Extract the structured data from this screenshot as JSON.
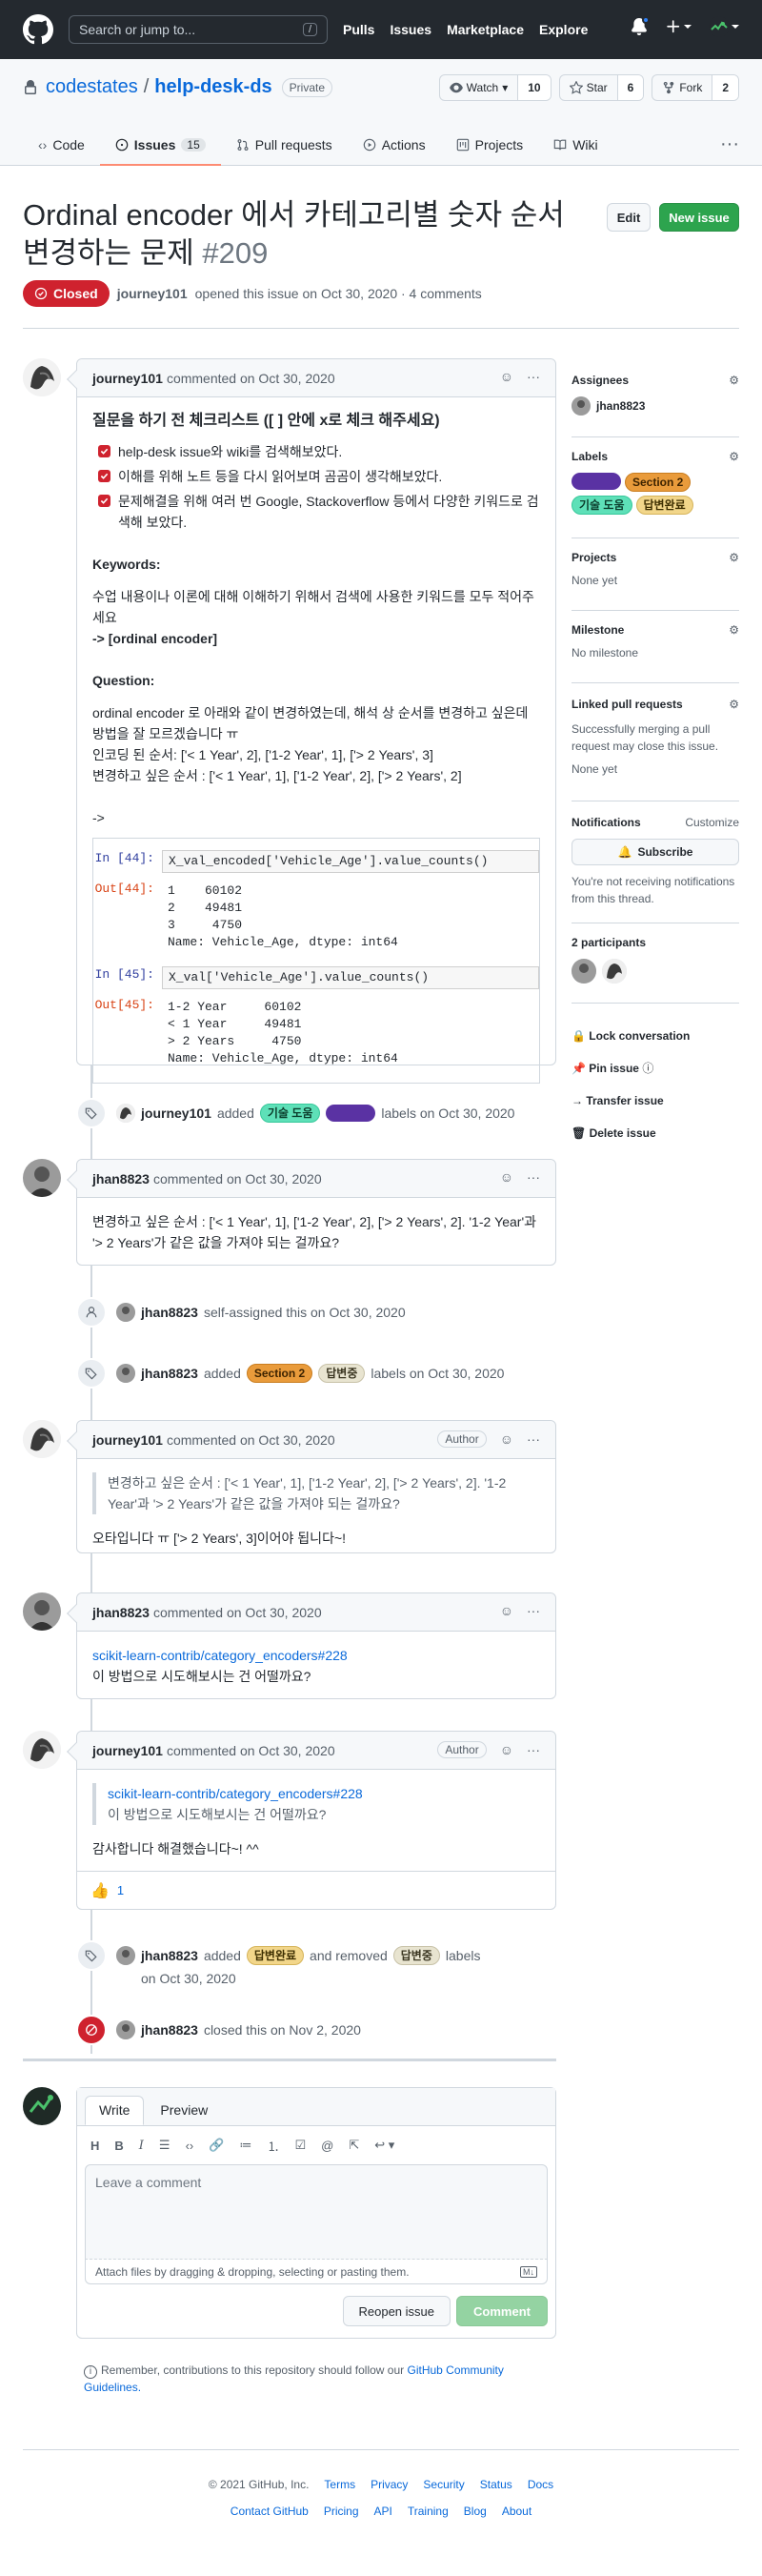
{
  "header": {
    "search_placeholder": "Search or jump to...",
    "search_key": "/",
    "nav": [
      "Pulls",
      "Issues",
      "Marketplace",
      "Explore"
    ]
  },
  "repo": {
    "owner": "codestates",
    "separator": "/",
    "name": "help-desk-ds",
    "visibility": "Private",
    "watch_label": "Watch",
    "watch_count": "10",
    "star_label": "Star",
    "star_count": "6",
    "fork_label": "Fork",
    "fork_count": "2",
    "tabs": [
      {
        "label": "Code"
      },
      {
        "label": "Issues",
        "count": "15"
      },
      {
        "label": "Pull requests"
      },
      {
        "label": "Actions"
      },
      {
        "label": "Projects"
      },
      {
        "label": "Wiki"
      }
    ]
  },
  "issue": {
    "title": "Ordinal encoder 에서 카테고리별 숫자 순서 변경하는 문제",
    "number": "#209",
    "edit_label": "Edit",
    "new_issue_label": "New issue",
    "state": "Closed",
    "author": "journey101",
    "meta_text": "opened this issue on Oct 30, 2020 · 4 comments"
  },
  "first_comment": {
    "author": "journey101",
    "meta": "commented on Oct 30, 2020",
    "heading": "질문을 하기 전 체크리스트 ([ ] 안에 x로 체크 해주세요)",
    "tasks": [
      "help-desk issue와 wiki를 검색해보았다.",
      "이해를 위해 노트 등을 다시 읽어보며 곰곰이 생각해보았다.",
      "문제해결을 위해 여러 번 Google, Stackoverflow 등에서 다양한 키워드로 검색해 보았다."
    ],
    "keywords_h": "Keywords:",
    "keywords_text": "수업 내용이나 이론에 대해 이해하기 위해서 검색에 사용한 키워드를 모두 적어주세요",
    "keywords_value": "-> [ordinal encoder]",
    "question_h": "Question:",
    "q1": "ordinal encoder 로 아래와 같이 변경하였는데, 해석 상 순서를 변경하고 싶은데 방법을 잘 모르겠습니다 ㅠ",
    "q2": "인코딩 된 순서: ['< 1 Year', 2], ['1-2 Year', 1], ['> 2 Years', 3]",
    "q3": "변경하고 싶은 순서 : ['< 1 Year', 1], ['1-2 Year', 2], ['> 2 Years', 2]",
    "arrow": "->",
    "code": {
      "in1_prompt": "In [44]:",
      "in1": "X_val_encoded['Vehicle_Age'].value_counts()",
      "out1_prompt": "Out[44]:",
      "out1": "1    60102\n2    49481\n3     4750\nName: Vehicle_Age, dtype: int64",
      "in2_prompt": "In [45]:",
      "in2": "X_val['Vehicle_Age'].value_counts()",
      "out2_prompt": "Out[45]:",
      "out2": "1-2 Year     60102\n< 1 Year     49481\n> 2 Years     4750\nName: Vehicle_Age, dtype: int64"
    }
  },
  "events": {
    "e1_user": "journey101",
    "e1_pre": "added",
    "e1_post": "labels on Oct 30, 2020",
    "e2_user": "jhan8823",
    "e2_text": "self-assigned this on Oct 30, 2020",
    "e3_user": "jhan8823",
    "e3_pre": "added",
    "e3_post": "labels on Oct 30, 2020",
    "e4_user": "jhan8823",
    "e4_pre": "added",
    "e4_mid": "and removed",
    "e4_post": "labels",
    "e4_date": "on Oct 30, 2020",
    "e5_user": "jhan8823",
    "e5_text": "closed this on Nov 2, 2020"
  },
  "labels": {
    "skill": "기술 도움",
    "purple": "",
    "section2": "Section 2",
    "answering": "답변중",
    "answered": "답변완료"
  },
  "comments": [
    {
      "author": "jhan8823",
      "meta": "commented on Oct 30, 2020",
      "body": "변경하고 싶은 순서 : ['< 1 Year', 1], ['1-2 Year', 2], ['> 2 Years', 2]. '1-2 Year'과 '> 2 Years'가 같은 값을 가져야 되는 걸까요?"
    },
    {
      "author": "journey101",
      "meta": "commented on Oct 30, 2020",
      "tag": "Author",
      "quote": "변경하고 싶은 순서 : ['< 1 Year', 1], ['1-2 Year', 2], ['> 2 Years', 2]. '1-2 Year'과 '> 2 Years'가 같은 값을 가져야 되는 걸까요?",
      "body": "오타입니다 ㅠ ['> 2 Years', 3]이어야 됩니다~!"
    },
    {
      "author": "jhan8823",
      "meta": "commented on Oct 30, 2020",
      "link": "scikit-learn-contrib/category_encoders#228",
      "body": "이 방법으로 시도해보시는 건 어떨까요?"
    },
    {
      "author": "journey101",
      "meta": "commented on Oct 30, 2020",
      "tag": "Author",
      "quote_link": "scikit-learn-contrib/category_encoders#228",
      "quote": "이 방법으로 시도해보시는 건 어떨까요?",
      "body": "감사합니다 해결했습니다~! ^^",
      "reaction_emoji": "👍",
      "reaction_count": "1"
    }
  ],
  "sidebar": {
    "assignees_h": "Assignees",
    "assignee": "jhan8823",
    "labels_h": "Labels",
    "projects_h": "Projects",
    "projects_v": "None yet",
    "milestone_h": "Milestone",
    "milestone_v": "No milestone",
    "linked_h": "Linked pull requests",
    "linked_desc": "Successfully merging a pull request may close this issue.",
    "linked_v": "None yet",
    "notif_h": "Notifications",
    "customize": "Customize",
    "subscribe": "Subscribe",
    "notif_desc": "You're not receiving notifications from this thread.",
    "participants_h": "2 participants",
    "lock": "Lock conversation",
    "pin": "Pin issue",
    "transfer": "Transfer issue",
    "delete": "Delete issue"
  },
  "form": {
    "write": "Write",
    "preview": "Preview",
    "placeholder": "Leave a comment",
    "attach": "Attach files by dragging & dropping, selecting or pasting them.",
    "reopen": "Reopen issue",
    "comment": "Comment",
    "note_pre": "Remember, contributions to this repository should follow our",
    "note_link": "GitHub Community Guidelines."
  },
  "footer": {
    "row1": [
      "© 2021 GitHub, Inc.",
      "Terms",
      "Privacy",
      "Security",
      "Status",
      "Docs"
    ],
    "row2": [
      "Contact GitHub",
      "Pricing",
      "API",
      "Training",
      "Blog",
      "About"
    ]
  },
  "colors": {
    "closed": "#cf222e",
    "new_issue": "#2da44e",
    "label_skill": "#5ee0b8",
    "label_purple": "#5a32a3",
    "label_section2": "#e99b3b",
    "label_answering": "#e8e4d0",
    "label_answered": "#f2d68a"
  }
}
